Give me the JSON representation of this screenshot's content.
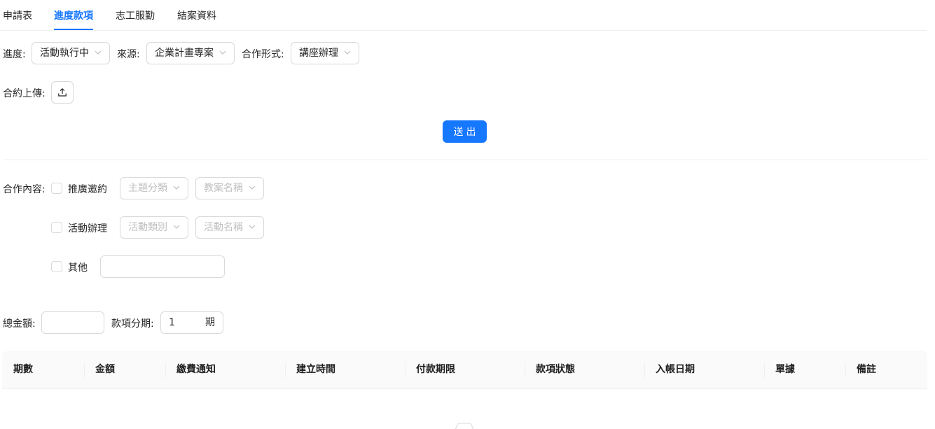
{
  "tabs": [
    {
      "label": "申請表",
      "active": false
    },
    {
      "label": "進度款項",
      "active": true
    },
    {
      "label": "志工服勤",
      "active": false
    },
    {
      "label": "結案資料",
      "active": false
    }
  ],
  "filters": {
    "progress": {
      "label": "進度:",
      "value": "活動執行中"
    },
    "source": {
      "label": "來源:",
      "value": "企業計畫專案"
    },
    "cooperation_form": {
      "label": "合作形式:",
      "value": "講座辦理"
    }
  },
  "contract": {
    "label": "合約上傳:",
    "upload_icon": "upload-icon"
  },
  "submit_label": "送出",
  "cooperation_content": {
    "label": "合作內容:",
    "options": [
      {
        "label": "推廣邀約",
        "checked": false,
        "select1": "主題分類",
        "select2": "教案名稱"
      },
      {
        "label": "活動辦理",
        "checked": false,
        "select1": "活動類別",
        "select2": "活動名稱"
      },
      {
        "label": "其他",
        "checked": false,
        "input_value": ""
      }
    ]
  },
  "amount": {
    "label": "總金額:",
    "value": ""
  },
  "installments": {
    "label": "款項分期:",
    "value": "1",
    "unit": "期"
  },
  "table": {
    "columns": [
      "期數",
      "金額",
      "繳費通知",
      "建立時間",
      "付款期限",
      "款項狀態",
      "入帳日期",
      "單據",
      "備註"
    ],
    "rows": []
  },
  "colors": {
    "accent": "#1677ff",
    "border": "#d9d9d9",
    "placeholder": "#bfbfbf",
    "header_bg": "#fafafa"
  }
}
